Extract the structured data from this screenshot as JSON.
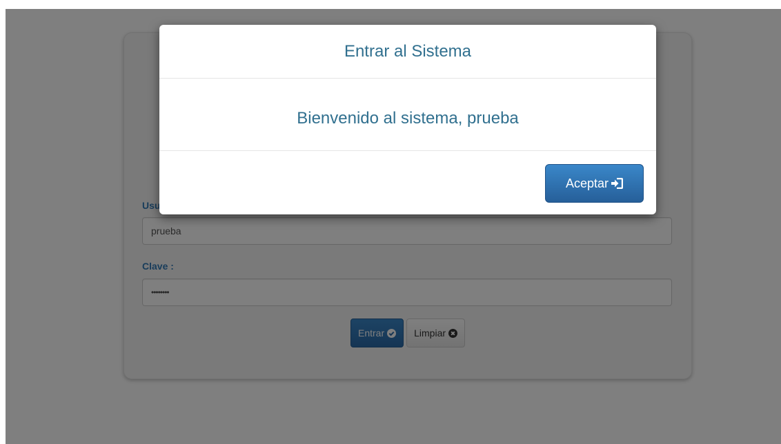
{
  "login_form": {
    "user_label": "Usuario :",
    "user_value": "prueba",
    "password_label": "Clave :",
    "password_value": "••••••••",
    "enter_label": "Entrar",
    "clear_label": "Limpiar"
  },
  "modal": {
    "title": "Entrar al Sistema",
    "message": "Bienvenido al sistema, prueba",
    "accept_label": "Aceptar"
  },
  "icons": {
    "enter": "check-circle-icon",
    "clear": "times-circle-icon",
    "accept": "sign-in-icon"
  },
  "colors": {
    "accent": "#337ab7",
    "modal_text": "#31708f",
    "backdrop": "#808080"
  }
}
